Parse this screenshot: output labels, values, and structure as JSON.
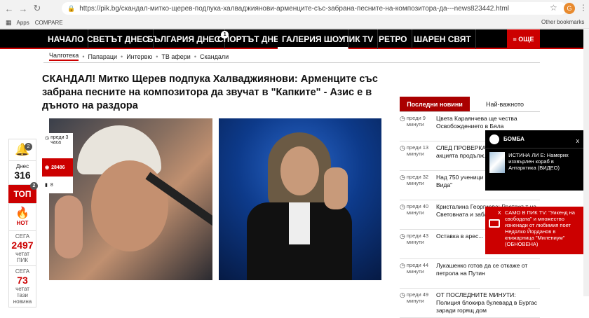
{
  "browser": {
    "url": "https://pik.bg/скандал-митко-щерев-подпука-халваджиянови-арменците-със-забрана-песните-на-композитора-да---news823442.html",
    "bookmarks": [
      "Apps",
      "COMPARE"
    ],
    "other_bookmarks": "Other bookmarks",
    "ext_letter": "G"
  },
  "nav": {
    "items": [
      "НАЧАЛО",
      "СВЕТЪТ ДНЕС",
      "БЪЛГАРИЯ ДНЕС",
      "СПОРТЪТ ДНЕС",
      "ГАЛЕРИЯ ШОУ",
      "ПИК TV",
      "РЕТРО",
      "ШАРЕН СВЯТ"
    ],
    "badge1": "1",
    "badge2": "1",
    "menu_label": "≡ ОЩЕ"
  },
  "subnav": [
    "Чалготека",
    "Папараци",
    "Интервю",
    "ТВ афери",
    "Скандали"
  ],
  "article": {
    "title": "СКАНДАЛ! Митко Щерев подпука Халваджиянови: Арменците със забрана песните на композитора да звучат в \"Капките\" - Азис е в дъното на раздора",
    "posted": "преди 3 часа",
    "views": "28486",
    "comments": "8"
  },
  "leftbar": {
    "bell_count": "2",
    "today_label": "Днес",
    "today_value": "316",
    "top_label": "ТОП",
    "top_badge": "2",
    "hot_label": "HOT",
    "now1_label": "СЕГА",
    "now1_value": "2497",
    "now1_caption": "четат ПИК",
    "now2_label": "СЕГА",
    "now2_value": "73",
    "now2_caption": "четат тази новина"
  },
  "sidebar": {
    "tab_latest": "Последни новини",
    "tab_important": "Най-важното",
    "news": [
      {
        "time": "преди 9 минути",
        "text": "Цвета Караянчева ще чества Освобождението в Бяла"
      },
      {
        "time": "преди 13 минути",
        "text": "СЛЕД ПРОВЕРКА: бензиностанции акцията продълж..."
      },
      {
        "time": "преди 32 минути",
        "text": "Над 750 ученици мартеница на кр... Вида\""
      },
      {
        "time": "преди 40 минути",
        "text": "Кристалина Георгиева: Растежът на Световната и забавя"
      },
      {
        "time": "преди 43 минути",
        "text": "Оставка в арес... таксиметровия ш..."
      },
      {
        "time": "преди 44 минути",
        "text": "Лукашенко готов да се откаже от петрола на Путин"
      },
      {
        "time": "преди 49 минути",
        "text": "ОТ ПОСЛЕДНИТЕ МИНУТИ: Полиция блокира булевард в Бургас заради горящ дом"
      }
    ]
  },
  "popup_bomb": {
    "title": "БОМБА",
    "close": "x",
    "text": "ИСТИНА ЛИ Е: Намерих изхвърлен кораб в Антарктика (ВИДЕО)"
  },
  "popup_tv": {
    "close": "x",
    "text": "САМО В ПИК TV: \"Уикенд на свободата\" и множество изненади от любимия поет Недялко Йорданов в книжарница \"Милениум\" (ОБНОВЕНА)"
  }
}
